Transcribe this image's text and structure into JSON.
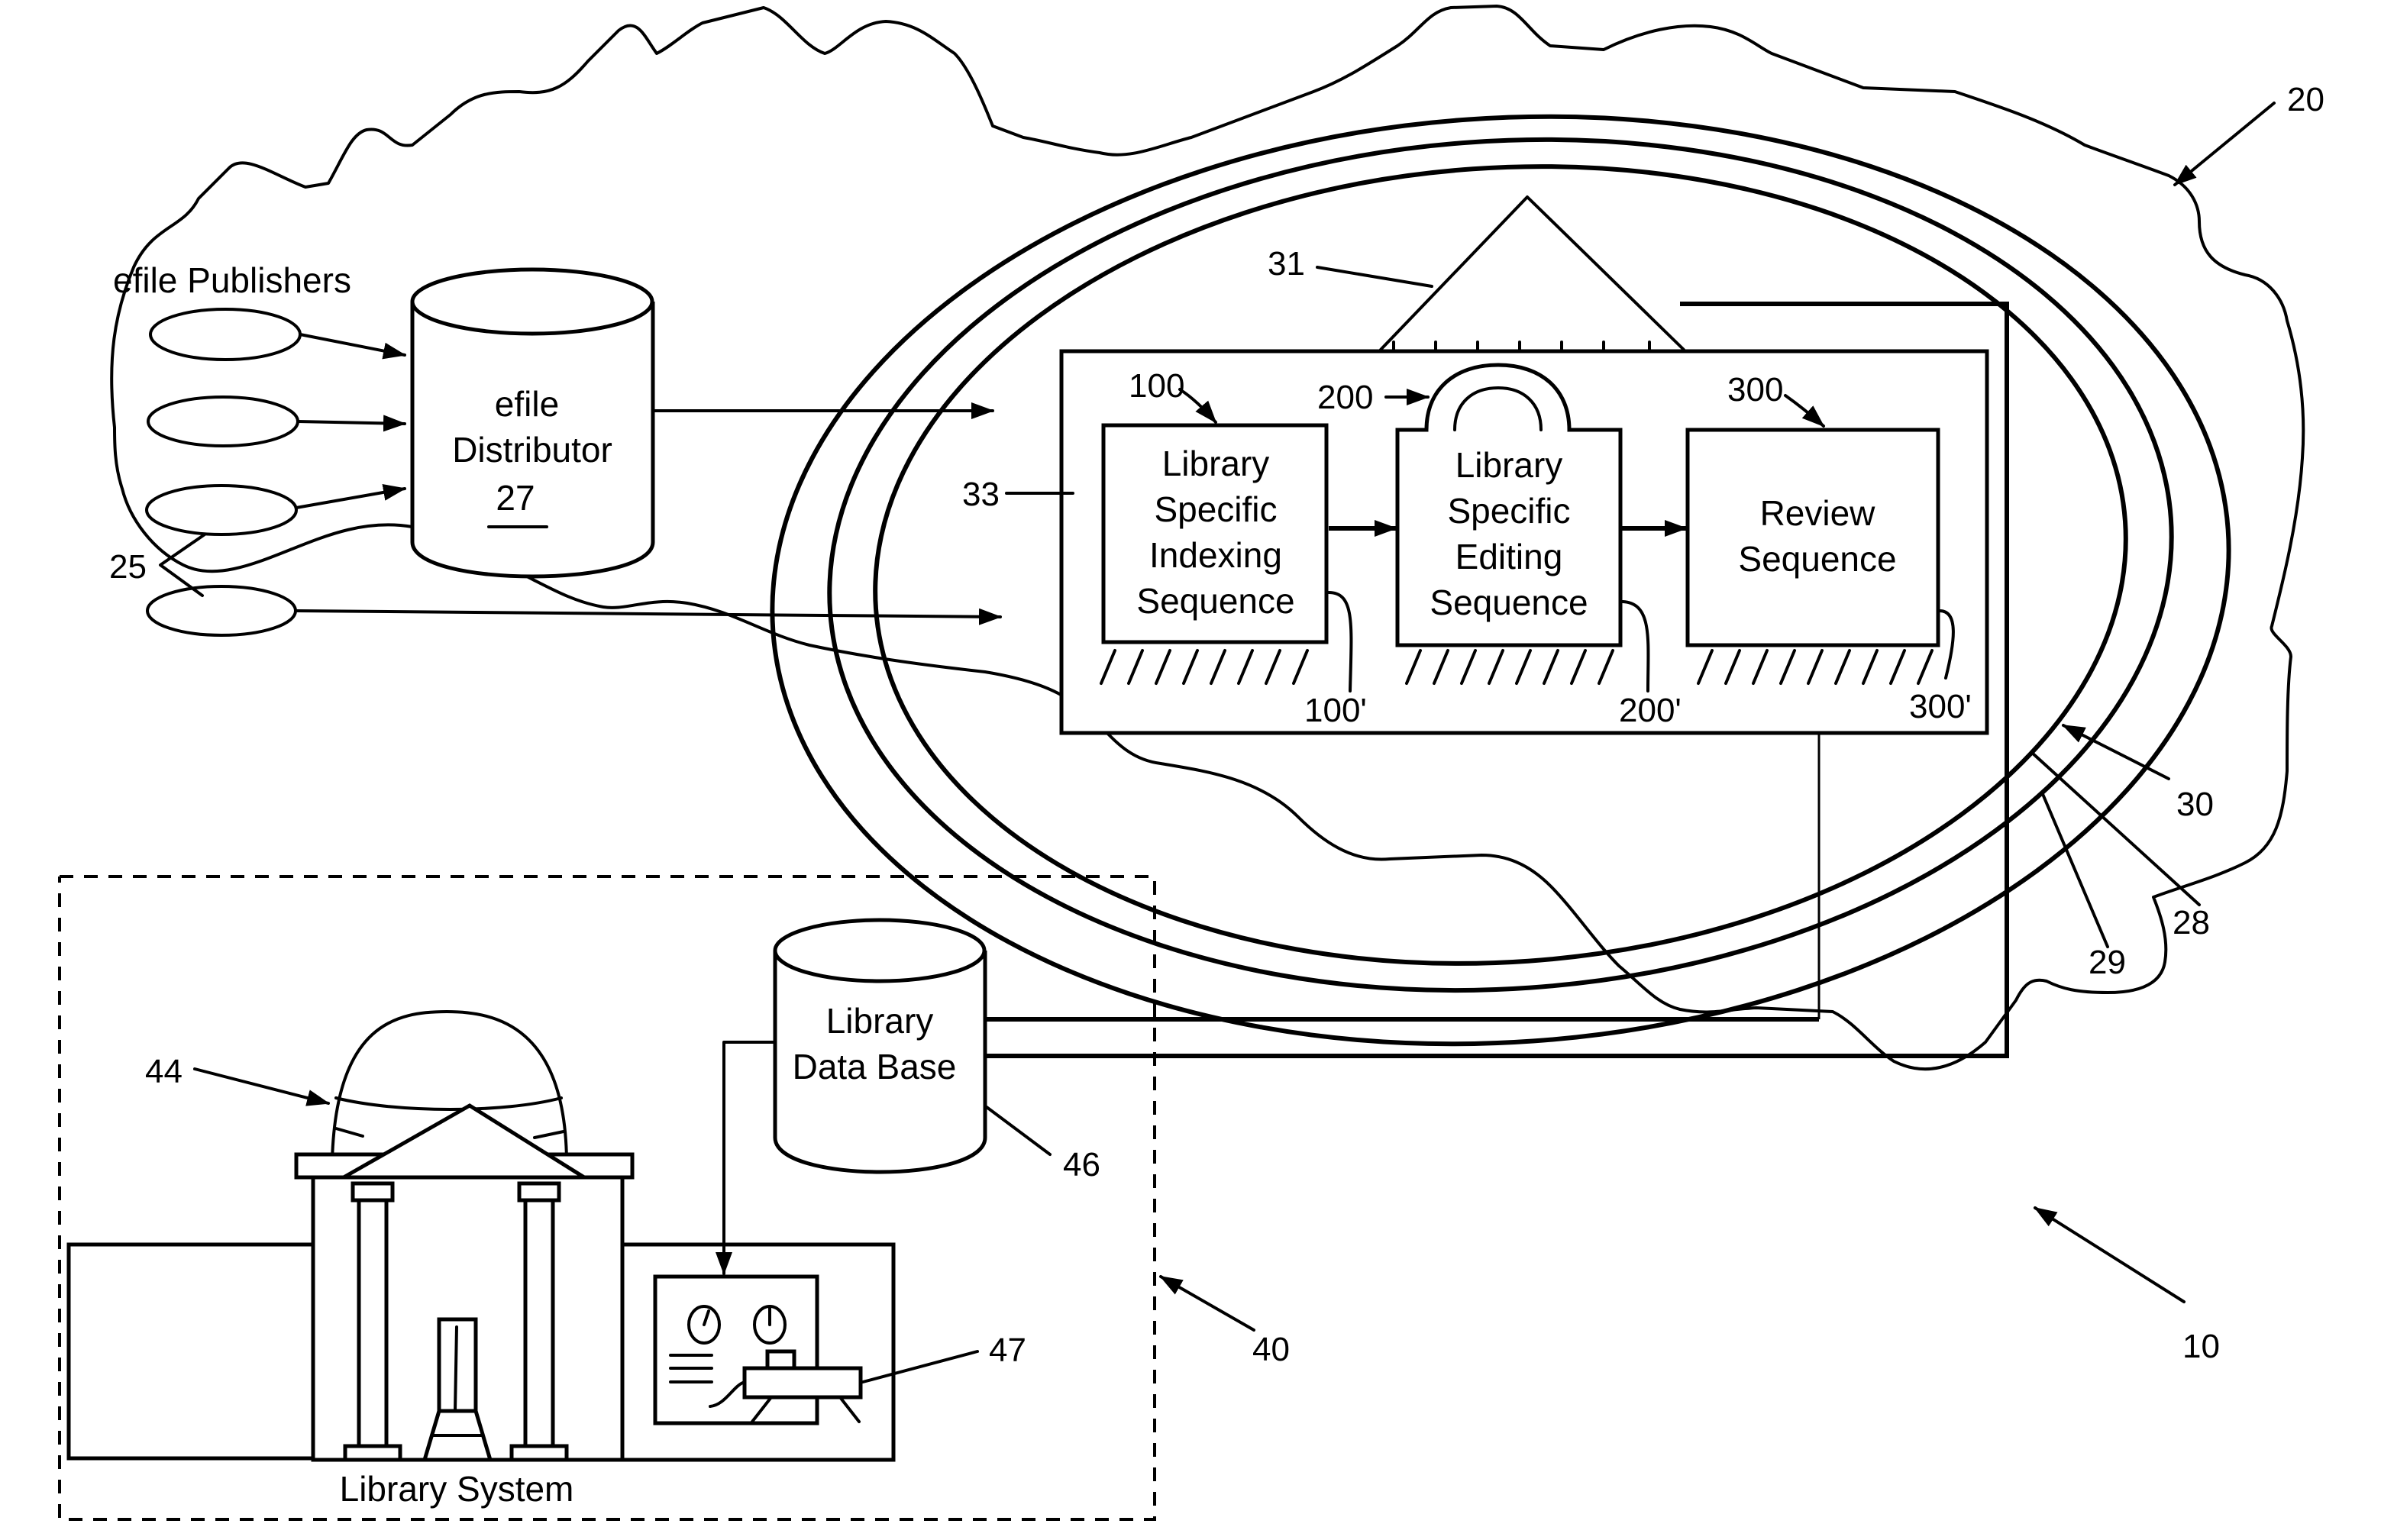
{
  "figure": {
    "reference_numerals": {
      "system": "10",
      "network_cloud": "20",
      "publishers": "25",
      "distributor": "27",
      "ring_28": "28",
      "ring_29": "29",
      "ring_30": "30",
      "triangle": "31",
      "module_box": "33",
      "library_system": "40",
      "library_building": "44",
      "library_database": "46",
      "terminal": "47",
      "indexing": "100",
      "indexing_prime": "100'",
      "editing": "200",
      "editing_prime": "200'",
      "review": "300",
      "review_prime": "300'"
    },
    "publishers_label": "efile Publishers",
    "distributor": {
      "line1": "efile",
      "line2": "Distributor",
      "number": "27"
    },
    "sequences": [
      {
        "id": "100",
        "lines": [
          "Library",
          "Specific",
          "Indexing",
          "Sequence"
        ]
      },
      {
        "id": "200",
        "lines": [
          "Library",
          "Specific",
          "Editing",
          "Sequence"
        ]
      },
      {
        "id": "300",
        "lines": [
          "Review",
          "Sequence"
        ]
      }
    ],
    "database": {
      "line1": "Library",
      "line2": "Data Base"
    },
    "library_system_label": "Library System"
  }
}
